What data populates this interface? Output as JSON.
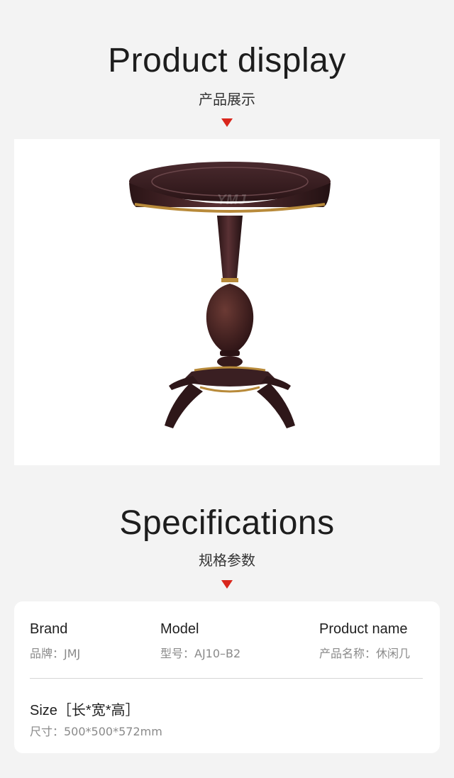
{
  "product_display": {
    "title": "Product display",
    "subtitle": "产品展示"
  },
  "photo": {
    "watermark": "YMJ",
    "subject_icon": "round-side-table-icon"
  },
  "specifications": {
    "title": "Specifications",
    "subtitle": "规格参数",
    "brand": {
      "label": "Brand",
      "value": "品牌：JMJ"
    },
    "model": {
      "label": "Model",
      "value": "型号：AJ10–B2"
    },
    "product_name": {
      "label": "Product name",
      "value": "产品名称：休闲几"
    },
    "size": {
      "label": "Size［长*宽*高］",
      "value": "尺寸：500*500*572mm"
    }
  },
  "colors": {
    "accent_arrow": "#d9261c",
    "wood_dark": "#3a1f22",
    "gold_trim": "#b88a3a"
  }
}
